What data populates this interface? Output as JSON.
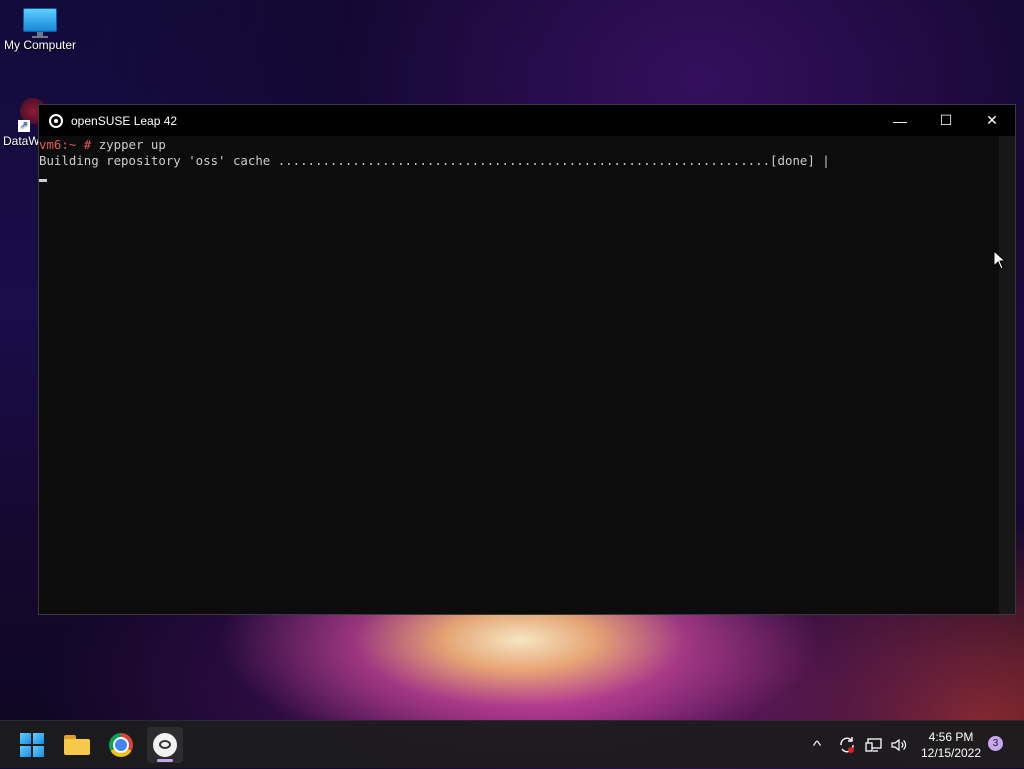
{
  "desktop": {
    "icons": [
      {
        "label": "My Computer",
        "icon": "monitor-icon"
      },
      {
        "label": "DataW",
        "icon": "shortcut-icon"
      }
    ]
  },
  "window": {
    "title": "openSUSE Leap 42",
    "minimize_symbol": "—",
    "maximize_symbol": "☐",
    "close_symbol": "✕",
    "terminal": {
      "prompt_host": "vm6:~ ",
      "prompt_hash": "# ",
      "command": "zypper up",
      "output_line": "Building repository 'oss' cache ..................................................................[done] |"
    }
  },
  "taskbar": {
    "apps": [
      "start-menu",
      "file-explorer",
      "chrome",
      "opensuse-terminal"
    ],
    "tray": {
      "chevron": "^",
      "time": "4:56 PM",
      "date": "12/15/2022",
      "notification_count": "3"
    }
  },
  "colors": {
    "prompt": "#e35a5a",
    "terminal_text": "#cccccc",
    "terminal_bg": "#0c0c0c",
    "accent_indicator": "#c9a6f0"
  }
}
